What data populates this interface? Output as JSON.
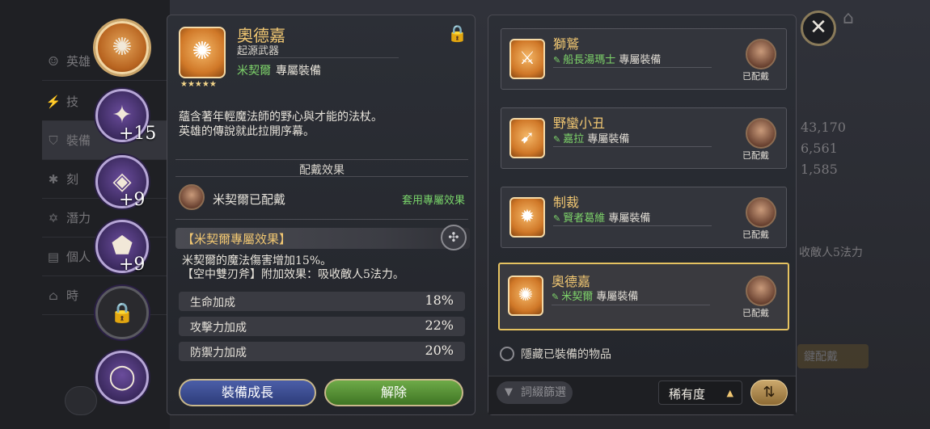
{
  "background": {
    "side_menu": [
      "英雄",
      "技",
      "裝備",
      "刻",
      "潛力",
      "個人",
      "時"
    ],
    "stats": [
      "43,170",
      "6,561",
      "1,585"
    ],
    "right_fragment": "收敵人5法力",
    "button_fragment": "鍵配戴"
  },
  "slots": [
    {
      "icon": "magic-staff-icon",
      "glyph": "✺"
    },
    {
      "icon": "star-amulet-icon",
      "glyph": "✦",
      "plus": "+15"
    },
    {
      "icon": "armor-icon",
      "glyph": "◈",
      "plus": "+9"
    },
    {
      "icon": "shield-emblem-icon",
      "glyph": "⬟",
      "plus": "+9"
    },
    {
      "icon": "lock-icon",
      "glyph": "🔒"
    },
    {
      "icon": "ring-icon",
      "glyph": "◯"
    }
  ],
  "detail": {
    "name": "奧德嘉",
    "subtitle": "起源武器",
    "hero": "米契爾",
    "hero_tag": "專屬裝備",
    "stars": "★★★★★",
    "description": "蘊含著年輕魔法師的野心與才能的法杖。\n英雄的傳說就此拉開序幕。",
    "equip_section": "配戴效果",
    "equipped_by": "米契爾已配戴",
    "apply_link": "套用專屬效果",
    "exclusive_title": "【米契爾專屬效果】",
    "exclusive_desc": "米契爾的魔法傷害增加15%。\n【空中雙刃斧】附加效果：吸收敵人5法力。",
    "stats": [
      {
        "label": "生命加成",
        "value": "18%"
      },
      {
        "label": "攻擊力加成",
        "value": "22%"
      },
      {
        "label": "防禦力加成",
        "value": "20%"
      }
    ],
    "grow_button": "裝備成長",
    "unequip_button": "解除"
  },
  "list": {
    "items": [
      {
        "name": "獅鷲",
        "hero": "船長湯瑪士",
        "tag": "專屬裝備",
        "status": "已配戴",
        "icon": "blade-icon",
        "glyph": "⚔"
      },
      {
        "name": "野蠻小丑",
        "hero": "嘉拉",
        "tag": "專屬裝備",
        "status": "已配戴",
        "icon": "bow-icon",
        "glyph": "➹"
      },
      {
        "name": "制裁",
        "hero": "賢者葛維",
        "tag": "專屬裝備",
        "status": "已配戴",
        "icon": "sun-emblem-icon",
        "glyph": "✹"
      },
      {
        "name": "奧德嘉",
        "hero": "米契爾",
        "tag": "專屬裝備",
        "status": "已配戴",
        "icon": "magic-staff-icon",
        "glyph": "✺"
      }
    ],
    "hide_label": "隱藏已裝備的物品",
    "filter_label": "詞綴篩選",
    "sort_label": "稀有度"
  },
  "colors": {
    "gold": "#f1c772",
    "green": "#7ed46a",
    "selected_border": "#e5c261"
  }
}
